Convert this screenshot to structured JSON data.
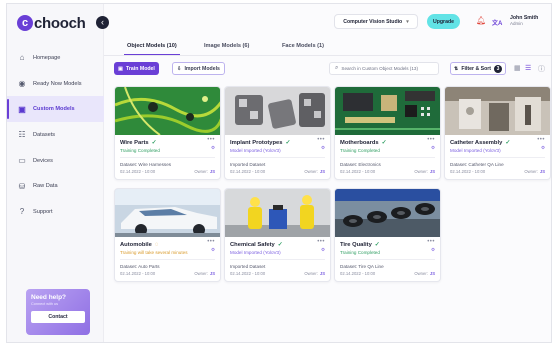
{
  "brand": {
    "logo_text": "chooch",
    "accent": "#6a3fd6"
  },
  "sidebar": {
    "items": [
      {
        "label": "Homepage",
        "icon": "home-icon",
        "glyph": "⌂"
      },
      {
        "label": "Ready Now Models",
        "icon": "eye-icon",
        "glyph": "◉"
      },
      {
        "label": "Custom Models",
        "icon": "cube-icon",
        "glyph": "▣"
      },
      {
        "label": "Datasets",
        "icon": "dataset-icon",
        "glyph": "☷"
      },
      {
        "label": "Devices",
        "icon": "device-icon",
        "glyph": "▭"
      },
      {
        "label": "Raw Data",
        "icon": "storage-icon",
        "glyph": "⛁"
      },
      {
        "label": "Support",
        "icon": "help-icon",
        "glyph": "?"
      }
    ],
    "active_index": 2,
    "help": {
      "title": "Need help?",
      "subtitle": "Connect with us",
      "button": "Contact"
    }
  },
  "topbar": {
    "workspace": "Computer Vision Studio",
    "upgrade": "Upgrade",
    "language": "文A",
    "user_name": "John Smith",
    "user_role": "Admin"
  },
  "tabs": [
    {
      "label": "Object Models (10)",
      "active": true
    },
    {
      "label": "Image Models (6)",
      "active": false
    },
    {
      "label": "Face Models (1)",
      "active": false
    }
  ],
  "toolbar": {
    "train_label": "Train Model",
    "import_label": "Import Models",
    "search_placeholder": "Search in Custom Object Models (13)",
    "filter_label": "Filter & Sort",
    "filter_count": "3"
  },
  "cards": [
    {
      "name": "Wire Parts",
      "icon": "check",
      "status": "Training Completed",
      "status_color": "green",
      "mode": "",
      "dataset": "Dataset: Wire Harnesses",
      "date": "02.14.2022 - 10:00",
      "owner": "Owner:",
      "owner_initials": "JS"
    },
    {
      "name": "Implant Prototypes",
      "icon": "check",
      "status": "Model Imported (YoloV3)",
      "status_color": "purple",
      "mode": "",
      "dataset": "Imported Dataset",
      "date": "02.14.2022 - 10:00",
      "owner": "Owner:",
      "owner_initials": "JS"
    },
    {
      "name": "Motherboards",
      "icon": "check",
      "status": "Training Completed",
      "status_color": "green",
      "mode": "",
      "dataset": "Dataset: Electronics",
      "date": "02.14.2022 - 10:00",
      "owner": "Owner:",
      "owner_initials": "JS"
    },
    {
      "name": "Catheter Assembly",
      "icon": "check",
      "status": "Model Imported (YoloV3)",
      "status_color": "purple",
      "mode": "",
      "dataset": "Dataset: Catheter QA Line",
      "date": "02.14.2022 - 10:00",
      "owner": "Owner:",
      "owner_initials": "JS"
    },
    {
      "name": "Automobile",
      "icon": "spin",
      "status": "Training will take several minutes",
      "status_color": "orange",
      "mode": "",
      "dataset": "Dataset: Auto Parts",
      "date": "02.14.2022 - 10:00",
      "owner": "Owner:",
      "owner_initials": "JS"
    },
    {
      "name": "Chemical Safety",
      "icon": "check",
      "status": "Model Imported (YoloV3)",
      "status_color": "purple",
      "mode": "",
      "dataset": "Imported Dataset",
      "date": "02.14.2022 - 10:00",
      "owner": "Owner:",
      "owner_initials": "JS"
    },
    {
      "name": "Tire Quality",
      "icon": "check",
      "status": "Training Completed",
      "status_color": "green",
      "mode": "",
      "dataset": "Dataset: Tire QA Line",
      "date": "02.14.2022 - 10:00",
      "owner": "Owner:",
      "owner_initials": "JS"
    }
  ]
}
